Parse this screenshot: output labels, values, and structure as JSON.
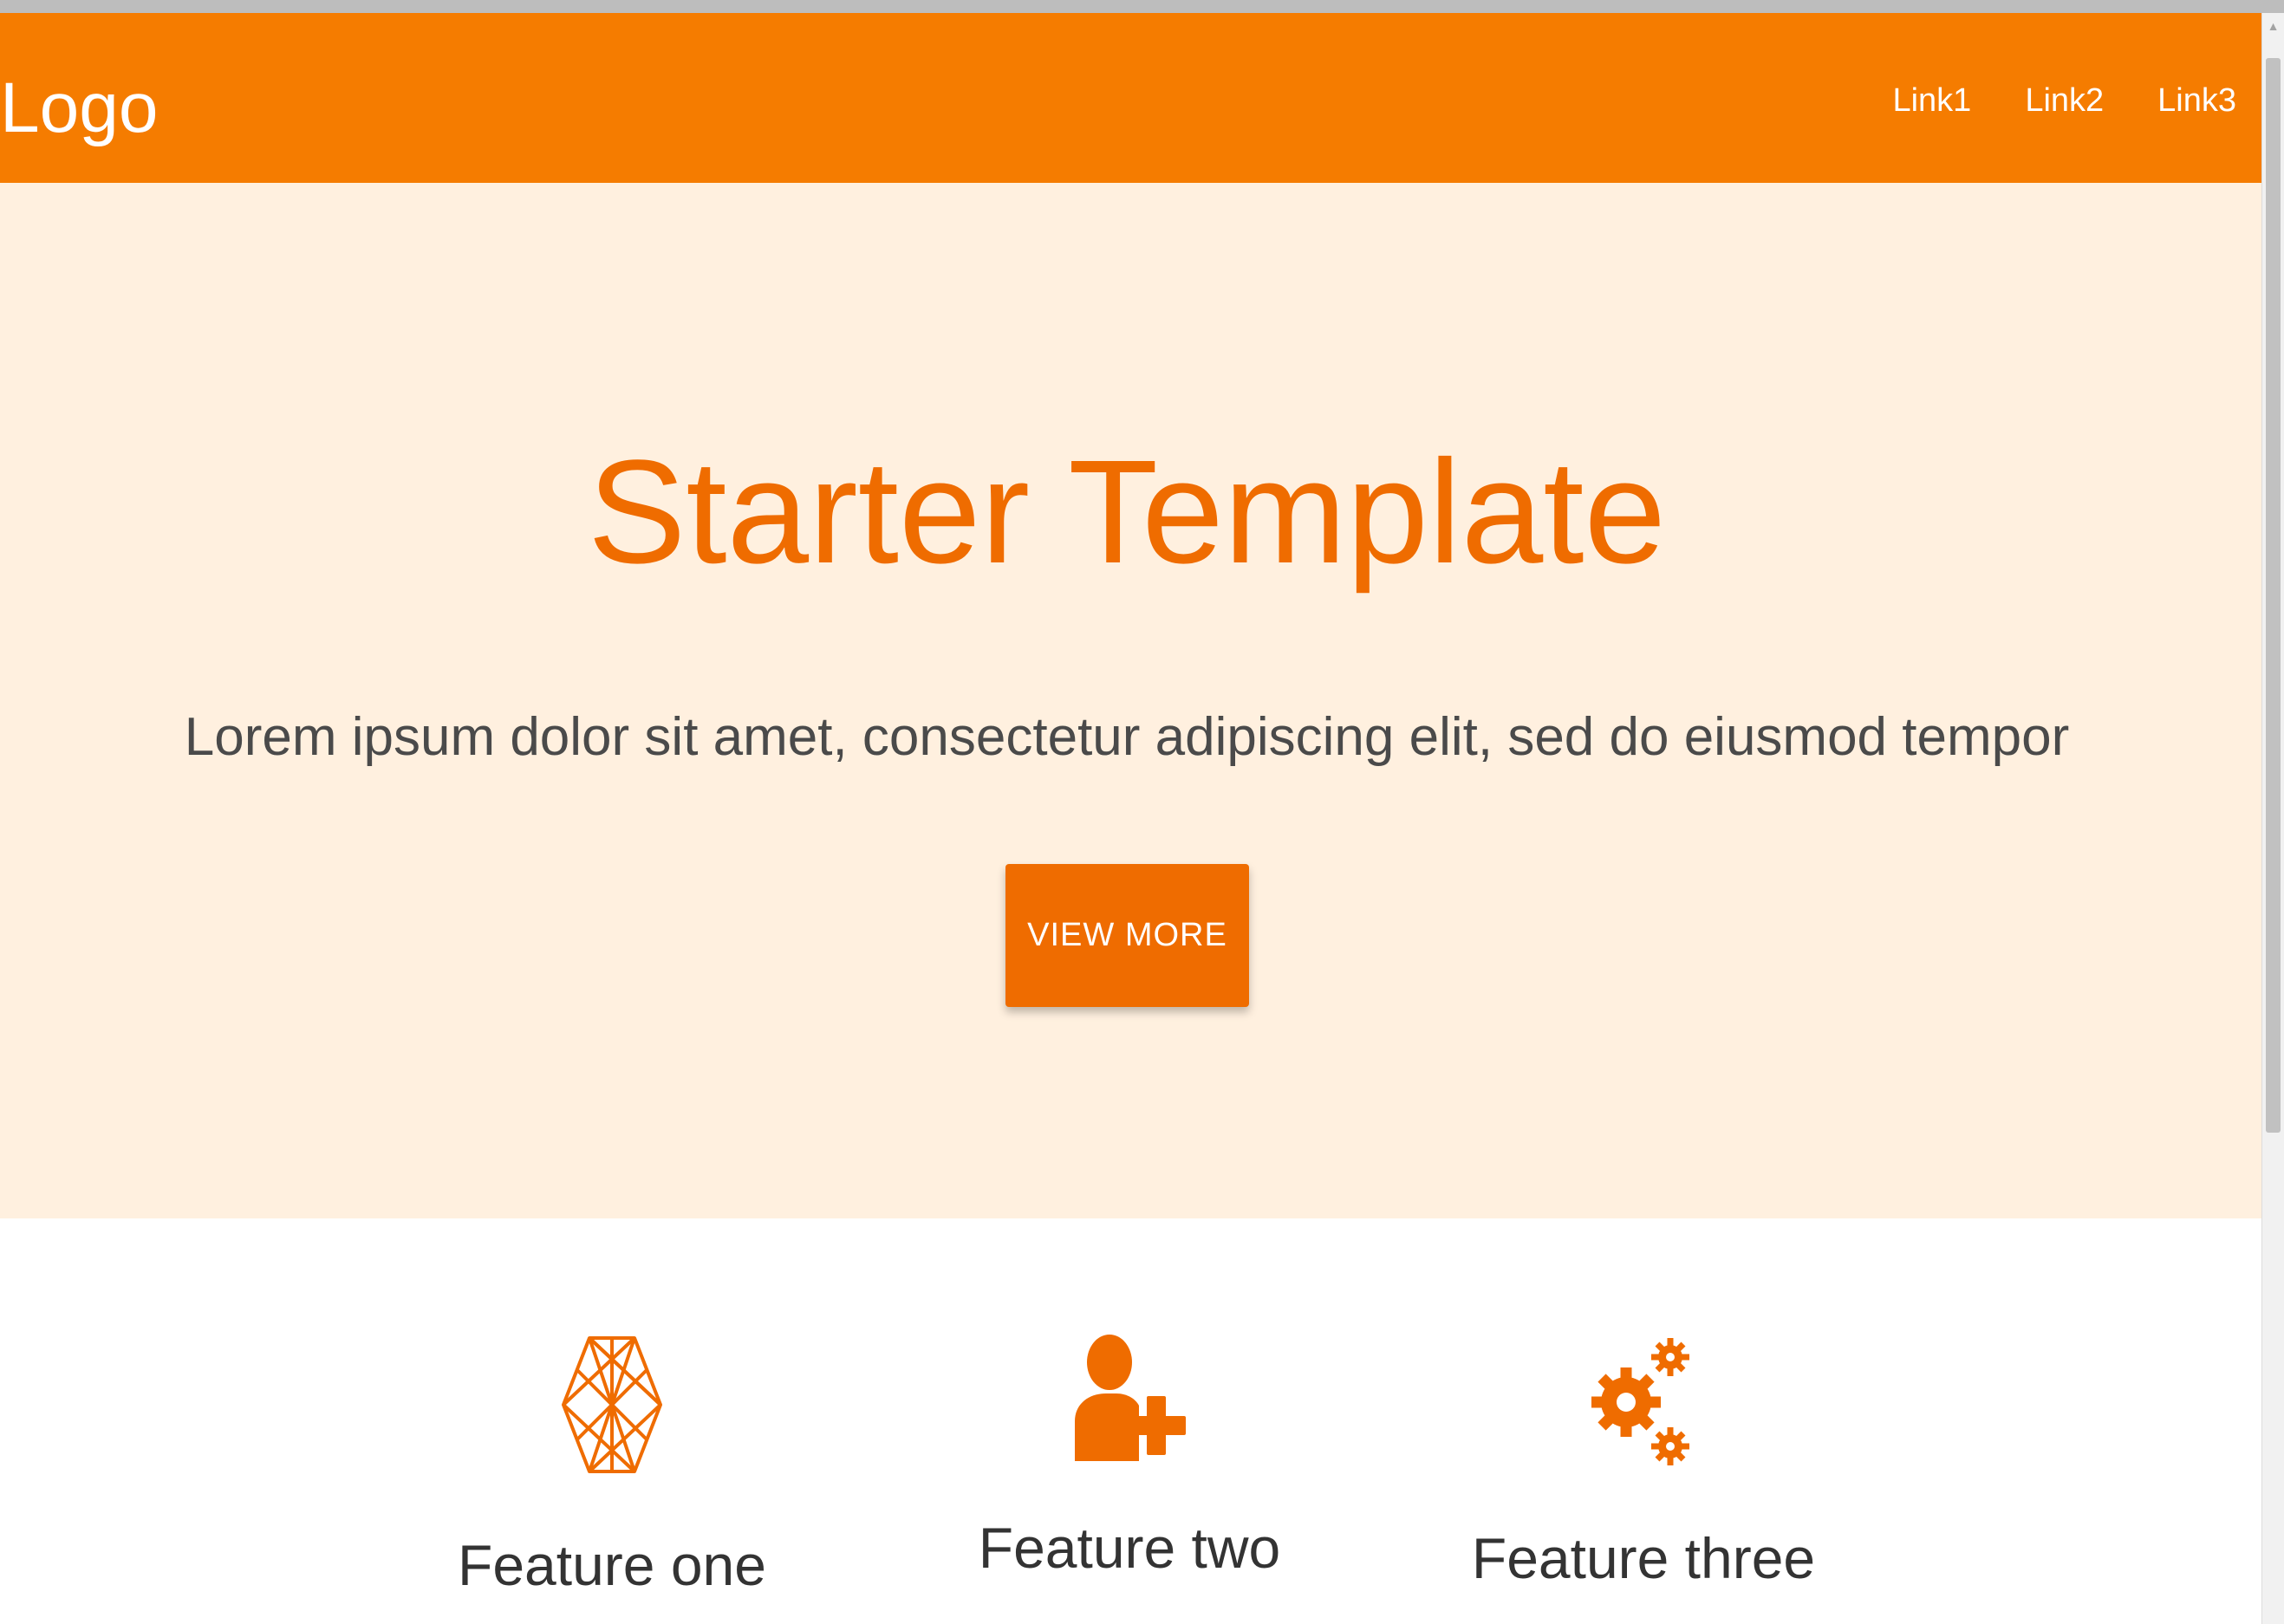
{
  "colors": {
    "primary": "#f57c00",
    "primary_dark": "#ef6c00",
    "hero_background": "#fff0df",
    "body_text": "#333333"
  },
  "navbar": {
    "logo": "Logo",
    "links": [
      "Link1",
      "Link2",
      "Link3"
    ]
  },
  "hero": {
    "title": "Starter Template",
    "text": "Lorem ipsum dolor sit amet, consectetur adipiscing elit, sed do eiusmod tempor",
    "button_label": "VIEW MORE"
  },
  "features": [
    {
      "icon": "hexagon-mesh-icon",
      "title": "Feature one"
    },
    {
      "icon": "add-user-icon",
      "title": "Feature two"
    },
    {
      "icon": "gears-icon",
      "title": "Feature three"
    }
  ]
}
